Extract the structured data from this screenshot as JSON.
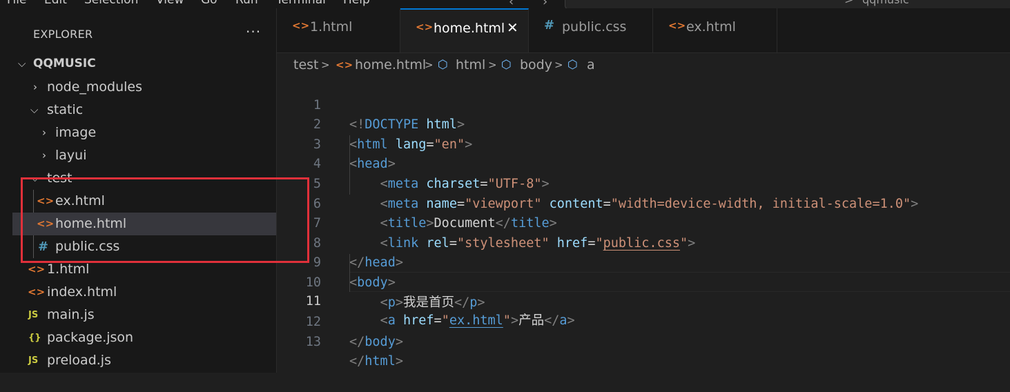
{
  "menu": {
    "items": [
      "File",
      "Edit",
      "Selection",
      "View",
      "Go",
      "Run",
      "Terminal",
      "Help"
    ],
    "back_arrow": "‹",
    "forward_arrow": "›",
    "command_center_text": "qqmusic"
  },
  "sidebar": {
    "title": "EXPLORER",
    "more_actions": "···",
    "tree": [
      {
        "label": "QQMUSIC",
        "type": "root",
        "expanded": true
      },
      {
        "label": "node_modules",
        "type": "folder",
        "expanded": false
      },
      {
        "label": "static",
        "type": "folder",
        "expanded": true
      },
      {
        "label": "image",
        "type": "folder",
        "expanded": false
      },
      {
        "label": "layui",
        "type": "folder",
        "expanded": false
      },
      {
        "label": "test",
        "type": "folder",
        "expanded": true
      },
      {
        "label": "ex.html",
        "type": "html",
        "icon": "<>"
      },
      {
        "label": "home.html",
        "type": "html",
        "icon": "<>",
        "selected": true
      },
      {
        "label": "public.css",
        "type": "css",
        "icon": "#"
      },
      {
        "label": "1.html",
        "type": "html",
        "icon": "<>"
      },
      {
        "label": "index.html",
        "type": "html",
        "icon": "<>"
      },
      {
        "label": "main.js",
        "type": "js",
        "icon": "JS"
      },
      {
        "label": "package.json",
        "type": "json",
        "icon": "{}"
      },
      {
        "label": "preload.js",
        "type": "js",
        "icon": "JS"
      }
    ]
  },
  "tabs": [
    {
      "label": "1.html",
      "icon": "<>",
      "active": false
    },
    {
      "label": "home.html",
      "icon": "<>",
      "active": true,
      "close": "✕"
    },
    {
      "label": "public.css",
      "icon": "#",
      "active": false
    },
    {
      "label": "ex.html",
      "icon": "<>",
      "active": false
    }
  ],
  "breadcrumb": {
    "folder": "test",
    "file": "home.html",
    "nodes": [
      "html",
      "body",
      "a"
    ]
  },
  "editor": {
    "current_line": 11,
    "line_numbers": [
      "1",
      "2",
      "3",
      "4",
      "5",
      "6",
      "7",
      "8",
      "9",
      "10",
      "11",
      "12",
      "13"
    ]
  },
  "colors": {
    "tag": "#569cd6",
    "attribute": "#9cdcfe",
    "string": "#ce9178",
    "html_icon": "#e37933",
    "css_icon": "#519aba",
    "js_icon": "#cbcb41",
    "highlight_box": "#e0303a",
    "active_tab_border": "#0078d4"
  },
  "icons": {
    "html_file": "angle-brackets-icon",
    "css_file": "hash-icon",
    "js_file": "js-icon",
    "json_file": "braces-icon",
    "breadcrumb_node": "cube-icon"
  }
}
